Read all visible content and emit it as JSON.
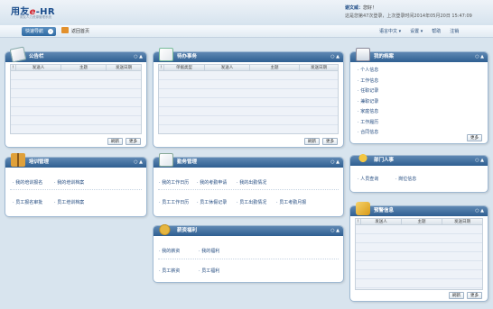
{
  "header": {
    "logo_main": "用友",
    "logo_e": "e",
    "logo_hr": "-HR",
    "slogan": "用友人力资源管理系统",
    "greeting_name": "谢文威：",
    "greeting_text": "您好！",
    "last_login": "这是您第47次登录，上次登录时间2014年05月20日 15:47:09"
  },
  "nav": {
    "quick_label": "快速导航",
    "back_label": "返回首页",
    "menu": [
      "语言中文 ▾",
      "设置 ▾",
      "帮助",
      "注销"
    ]
  },
  "panels": {
    "notice": {
      "title": "公告栏",
      "controls": "○ ▲",
      "columns": [
        "!",
        "发送人",
        "主题",
        "发送日期"
      ],
      "buttons": [
        "刷新",
        "更多"
      ]
    },
    "todo": {
      "title": "待办事务",
      "controls": "○ ▲",
      "columns": [
        "!",
        "单据类型",
        "发送人",
        "主题",
        "发送日期"
      ],
      "buttons": [
        "刷新",
        "更多"
      ]
    },
    "archive": {
      "title": "我的档案",
      "controls": "○ ▲",
      "items": [
        "个人信息",
        "工作信息",
        "任职记录",
        "兼职记录",
        "家庭信息",
        "工作履历",
        "合同信息"
      ],
      "button": "更多"
    },
    "training": {
      "title": "培训管理",
      "controls": "○ ▲",
      "links": [
        "我的培训报名",
        "我的培训档案",
        "员工报名审批",
        "员工培训档案"
      ]
    },
    "service": {
      "title": "勤务管理",
      "controls": "○ ▲",
      "links": [
        "我的工作日历",
        "我的考勤申请",
        "我的出勤情况",
        "员工工作日历",
        "员工休假记录",
        "员工出勤情况",
        "员工考勤月报"
      ]
    },
    "hr": {
      "title": "部门人事",
      "controls": "○ ▲",
      "links": [
        "人员查询",
        "岗位信息"
      ]
    },
    "salary": {
      "title": "薪资福利",
      "controls": "○ ▲",
      "links": [
        "我的薪资",
        "我的福利",
        "员工薪资",
        "员工福利"
      ]
    },
    "alert": {
      "title": "预警信息",
      "controls": "○ ▲",
      "columns": [
        "!",
        "发送人",
        "主题",
        "发送日期"
      ],
      "buttons": [
        "刷新",
        "更多"
      ]
    }
  }
}
